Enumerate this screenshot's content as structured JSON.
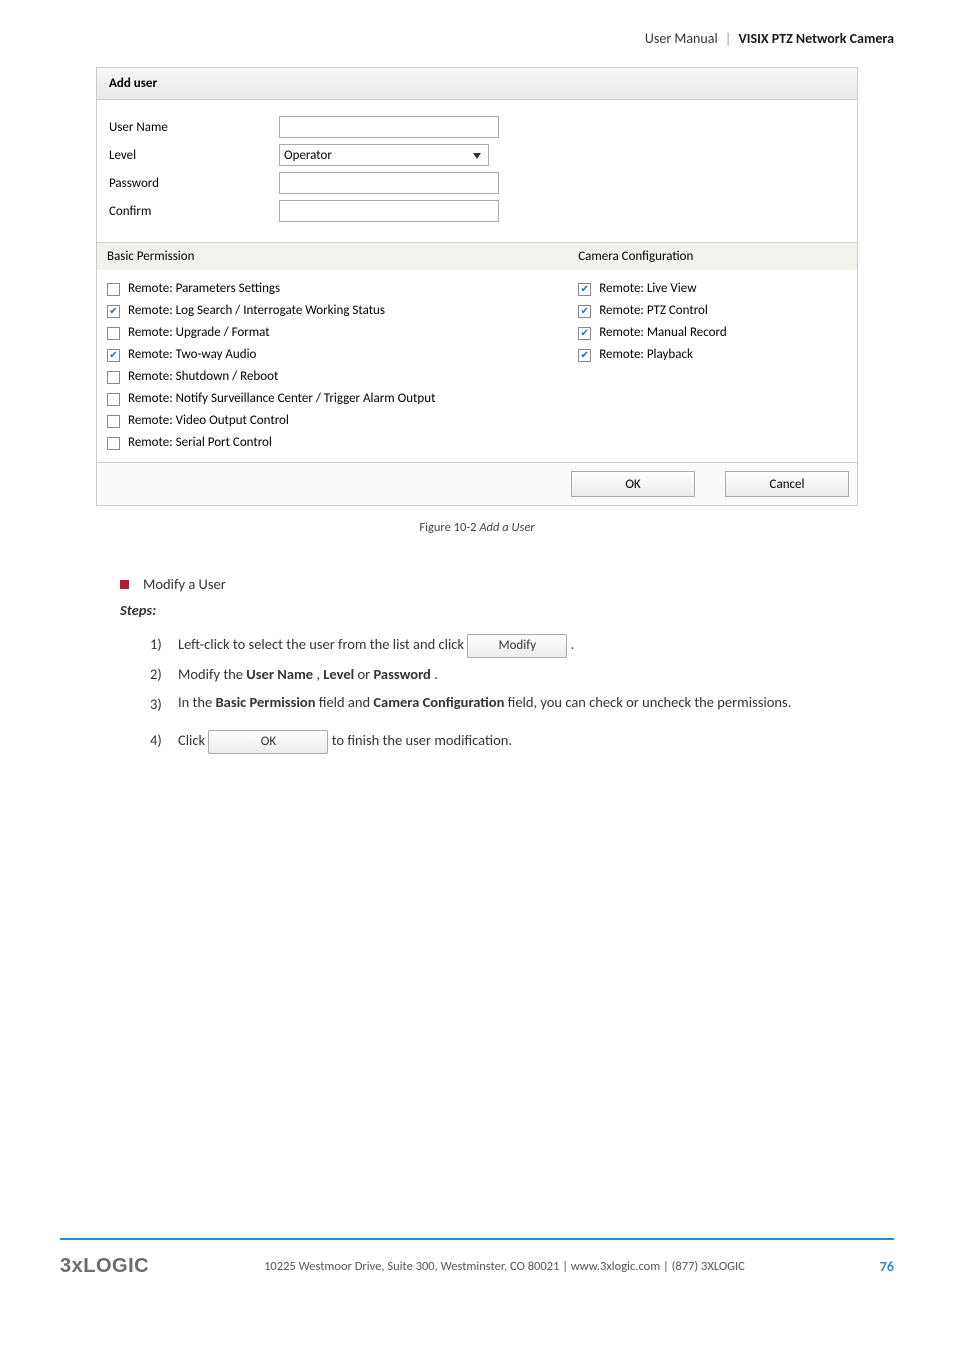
{
  "header": {
    "left": "User Manual",
    "right": "VISIX PTZ Network Camera"
  },
  "dialog": {
    "title": "Add user",
    "fields": {
      "userName": {
        "label": "User Name",
        "value": ""
      },
      "level": {
        "label": "Level",
        "value": "Operator"
      },
      "password": {
        "label": "Password",
        "value": ""
      },
      "confirm": {
        "label": "Confirm",
        "value": ""
      }
    },
    "basic": {
      "header": "Basic Permission",
      "items": [
        {
          "label": "Remote: Parameters Settings",
          "checked": false
        },
        {
          "label": "Remote: Log Search / Interrogate Working Status",
          "checked": true
        },
        {
          "label": "Remote: Upgrade / Format",
          "checked": false
        },
        {
          "label": "Remote: Two-way Audio",
          "checked": true
        },
        {
          "label": "Remote: Shutdown / Reboot",
          "checked": false
        },
        {
          "label": "Remote: Notify Surveillance Center / Trigger Alarm Output",
          "checked": false
        },
        {
          "label": "Remote: Video Output Control",
          "checked": false
        },
        {
          "label": "Remote: Serial Port Control",
          "checked": false
        }
      ]
    },
    "camera": {
      "header": "Camera Configuration",
      "items": [
        {
          "label": "Remote: Live View",
          "checked": true
        },
        {
          "label": "Remote: PTZ Control",
          "checked": true
        },
        {
          "label": "Remote: Manual Record",
          "checked": true
        },
        {
          "label": "Remote: Playback",
          "checked": true
        }
      ]
    },
    "buttons": {
      "ok": "OK",
      "cancel": "Cancel"
    }
  },
  "figure": {
    "prefix": "Figure 10-2",
    "title": "Add a User"
  },
  "body": {
    "modifyTitle": "Modify a User",
    "stepsLabel": "Steps:",
    "steps": {
      "s1a": "Left-click to select the user from the list and click",
      "s1btn": "Modify",
      "s1b": ".",
      "s2a": "Modify the ",
      "s2b1": "User Name",
      "s2c": ", ",
      "s2b2": "Level",
      "s2d": " or ",
      "s2b3": "Password",
      "s2e": ".",
      "s3a": "In the ",
      "s3b1": "Basic Permission",
      "s3c": " field and ",
      "s3b2": "Camera Configuration",
      "s3d": " field, you can check or uncheck the permissions.",
      "s4a": "Click",
      "s4btn": "OK",
      "s4b": "to finish the user modification."
    }
  },
  "footer": {
    "logo": "3xLOGIC",
    "text": "10225 Westmoor Drive, Suite 300, Westminster, CO 80021 | www.3xlogic.com | (877) 3XLOGIC",
    "page": "76"
  }
}
